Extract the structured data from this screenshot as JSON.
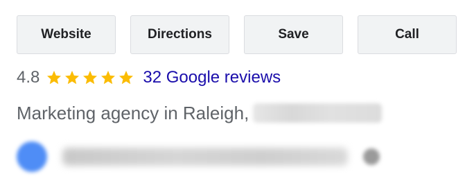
{
  "actions": {
    "website_label": "Website",
    "directions_label": "Directions",
    "save_label": "Save",
    "call_label": "Call"
  },
  "rating": {
    "value": "4.8",
    "stars_filled": 5,
    "stars_total": 5,
    "star_color": "#fbbc04",
    "reviews_label": "32 Google reviews"
  },
  "category": {
    "text": "Marketing agency in Raleigh,"
  },
  "colors": {
    "link": "#1a0dab",
    "muted_text": "#5f6368",
    "button_bg": "#f1f3f4",
    "avatar_blue": "#4f8df6"
  }
}
